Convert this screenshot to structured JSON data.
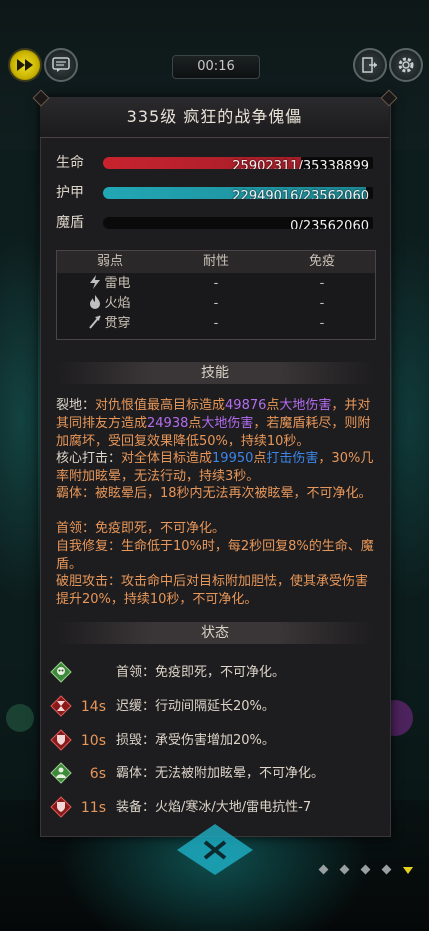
{
  "header": {
    "timer": "00:16",
    "speed_icon": "fast-forward-icon",
    "chat_icon": "chat-icon",
    "exit_icon": "exit-icon",
    "settings_icon": "gear-icon"
  },
  "boss": {
    "title": "335级  疯狂的战争傀儡"
  },
  "stats": [
    {
      "label": "生命",
      "value": "25902311/35338899",
      "fraction": 0.733,
      "color": "#c8232f"
    },
    {
      "label": "护甲",
      "value": "22949016/23562060",
      "fraction": 0.974,
      "color": "#22a7b5"
    },
    {
      "label": "魔盾",
      "value": "0/23562060",
      "fraction": 0.0,
      "color": "#5a4fc4"
    }
  ],
  "resistances": {
    "headers": [
      "弱点",
      "耐性",
      "免疫"
    ],
    "rows": [
      {
        "name": "雷电",
        "resist": "-",
        "immune": "-"
      },
      {
        "name": "火焰",
        "resist": "-",
        "immune": "-"
      },
      {
        "name": "贯穿",
        "resist": "-",
        "immune": "-"
      }
    ]
  },
  "skills_title": "技能",
  "skills": {
    "s1": {
      "name": "裂地：",
      "a": "对仇恨值最高目标造成",
      "n1": "49876",
      "b": "点",
      "t1": "大地伤害",
      "c": "，并对其同排友方造成",
      "n2": "24938",
      "d": "点",
      "t2": "大地伤害",
      "e": "，若魔盾耗尽，则附加腐坏，受回复效果降低50%，持续10秒。"
    },
    "s2": {
      "name": "核心打击：",
      "a": "对全体目标造成",
      "n1": "19950",
      "b": "点",
      "t1": "打击伤害",
      "c": "，30%几率附加眩晕，无法行动，持续3秒。"
    },
    "s3": "霸体：被眩晕后，18秒内无法再次被眩晕，不可净化。",
    "s4": "首领：免疫即死，不可净化。",
    "s5": "自我修复：生命低于10%时，每2秒回复8%的生命、魔盾。",
    "s6": "破胆攻击：攻击命中后对目标附加胆怯，使其承受伤害提升20%，持续10秒，不可净化。"
  },
  "status_title": "状态",
  "statuses": [
    {
      "time": "",
      "text": "首领：免疫即死，不可净化。",
      "icon": "skull-icon"
    },
    {
      "time": "14s",
      "text": "迟缓：行动间隔延长20%。",
      "icon": "hourglass-icon"
    },
    {
      "time": "10s",
      "text": "损毁：承受伤害增加20%。",
      "icon": "broken-shield-icon"
    },
    {
      "time": "6s",
      "text": "霸体：无法被附加眩晕，不可净化。",
      "icon": "warrior-icon"
    },
    {
      "time": "11s",
      "text": "装备：火焰/寒冰/大地/雷电抗性-7",
      "icon": "equip-shield-icon"
    }
  ],
  "colors": {
    "accent_orange": "#e8975a",
    "accent_purple": "#b46df0",
    "accent_blue": "#3c86e8"
  }
}
